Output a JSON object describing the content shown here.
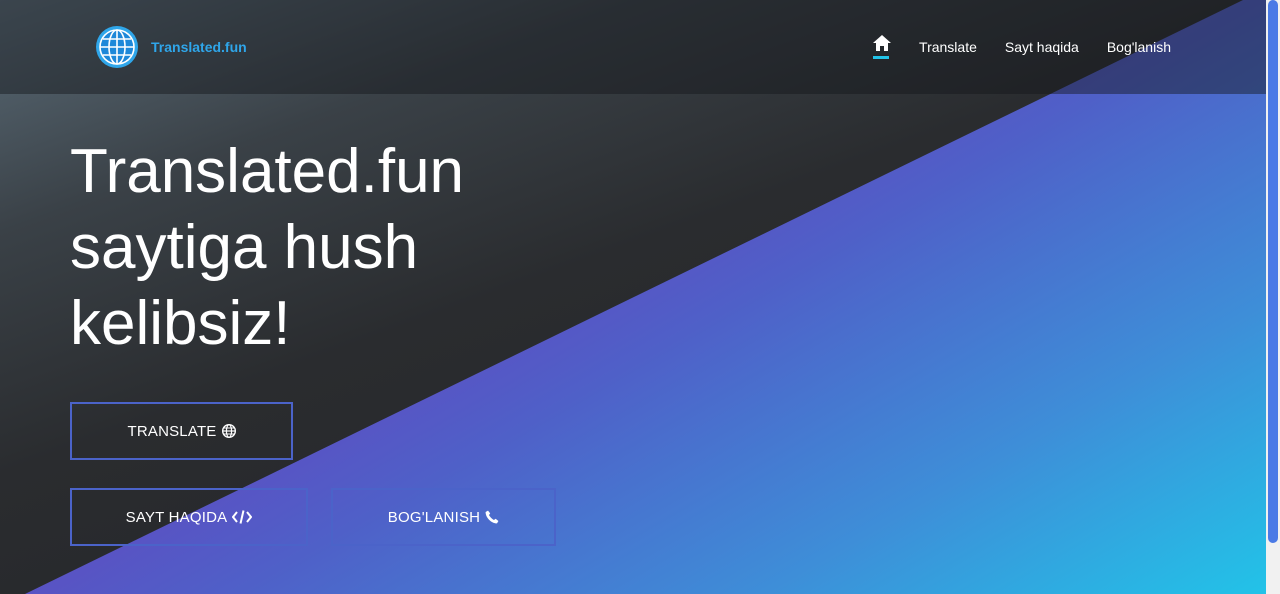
{
  "brand": {
    "name": "Translated.fun",
    "logo_icon": "globe-icon"
  },
  "nav": {
    "home_icon": "home-icon",
    "links": [
      "Translate",
      "Sayt haqida",
      "Bog'lanish"
    ]
  },
  "hero": {
    "title": "Translated.fun saytiga hush kelibsiz!"
  },
  "buttons": {
    "translate": {
      "label": "TRANSLATE",
      "icon": "globe-icon"
    },
    "about": {
      "label": "SAYT HAQIDA",
      "icon": "code-icon"
    },
    "contact": {
      "label": "BOG'LANISH",
      "icon": "phone-icon"
    }
  },
  "colors": {
    "accent": "#22c3e8",
    "brand_text": "#2fa6ea",
    "button_border": "#4b63c9",
    "purple": "#6a2fb8"
  }
}
